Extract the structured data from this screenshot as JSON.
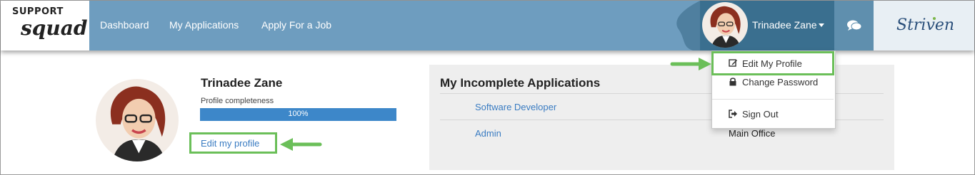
{
  "logo": {
    "top": "SUPPORT",
    "bottom": "squad"
  },
  "nav": {
    "items": [
      {
        "label": "Dashboard"
      },
      {
        "label": "My Applications"
      },
      {
        "label": "Apply For a Job"
      }
    ],
    "user_name": "Trinadee Zane",
    "brand": "Striven"
  },
  "dropdown": {
    "items": [
      {
        "label": "Edit My Profile",
        "icon": "edit-icon"
      },
      {
        "label": "Change Password",
        "icon": "lock-icon"
      },
      {
        "label": "Sign Out",
        "icon": "sign-out-icon"
      }
    ]
  },
  "profile": {
    "name": "Trinadee Zane",
    "completeness_label": "Profile completeness",
    "completeness_value": 100,
    "completeness_text": "100%",
    "edit_link": "Edit my profile"
  },
  "applications": {
    "title": "My Incomplete Applications",
    "rows": [
      {
        "job": "Software Developer",
        "location": ""
      },
      {
        "job": "Admin",
        "location": "Main Office"
      }
    ]
  },
  "colors": {
    "nav_bg": "#6e9dbf",
    "highlight": "#6bbf59",
    "link": "#3a7cc2",
    "progress": "#3d87c9"
  }
}
